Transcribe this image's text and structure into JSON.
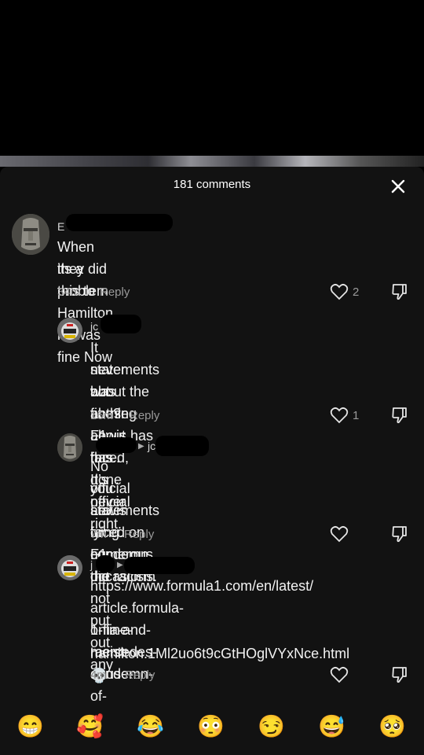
{
  "header": {
    "title": "181 comments"
  },
  "comments": [
    {
      "user": "E",
      "text_lines": [
        "When they did this to Hamilton its was fine Now",
        "its a problem"
      ],
      "time": "34m",
      "reply_label": "Reply",
      "likes": "2"
    },
    {
      "user": "jc",
      "text_lines": [
        "It never was fine? F1 has done official",
        "statements about the abuse Lewis has faced,",
        "but nothing about this.. It’s never right."
      ],
      "time": "16m",
      "reply_label": "Reply",
      "likes": "1"
    },
    {
      "user": "",
      "reply_to": "jc",
      "text_lines": [
        "No you are lying. F1 did not put out any",
        "official statements or condemn the racism",
        "Lewis faced on numerous occasions."
      ],
      "time": "7m",
      "reply_label": "Reply",
      "likes": ""
    },
    {
      "user": "j",
      "text_lines": [
        "https://www.formula1.com/en/latest/",
        "article.formula-1-fia-and-mercedes-condemn-",
        "online-racist-abuse-of-",
        "hamilton.1Ml2uo6t9cGtHOglVYxNce.html 💀"
      ],
      "time": "4m",
      "reply_label": "Reply",
      "likes": ""
    }
  ],
  "emojis": [
    "😁",
    "🥰",
    "😂",
    "😳",
    "😏",
    "😅",
    "🥺"
  ]
}
